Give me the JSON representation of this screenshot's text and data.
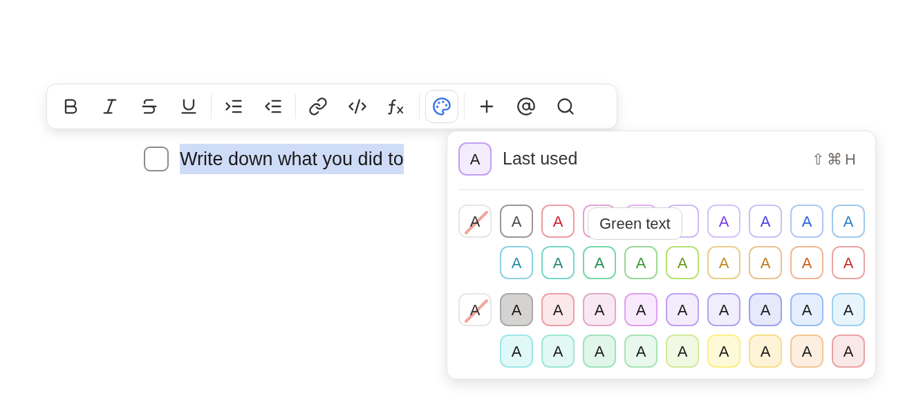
{
  "toolbar": {
    "groups": [
      [
        {
          "kind": "bold",
          "selected": false
        },
        {
          "kind": "italic",
          "selected": false
        },
        {
          "kind": "strike",
          "selected": false
        },
        {
          "kind": "underline",
          "selected": false
        }
      ],
      [
        {
          "kind": "indent",
          "selected": false
        },
        {
          "kind": "outdent",
          "selected": false
        }
      ],
      [
        {
          "kind": "link",
          "selected": false
        },
        {
          "kind": "code",
          "selected": false
        },
        {
          "kind": "formula",
          "selected": false
        }
      ],
      [
        {
          "kind": "palette",
          "selected": true
        }
      ],
      [
        {
          "kind": "plus",
          "selected": false
        },
        {
          "kind": "mention",
          "selected": false
        },
        {
          "kind": "search",
          "selected": false
        }
      ]
    ]
  },
  "task": {
    "checked": false,
    "text": "Write down what you did to"
  },
  "color_menu": {
    "last_used": {
      "label": "A",
      "color": "#f3ecfd",
      "title": "Last used",
      "shortcut": [
        "⇧",
        "⌘",
        "H"
      ]
    },
    "text_colors": {
      "none": {
        "label": "A"
      },
      "tooltip": "Green text",
      "swatches": [
        {
          "label": "A",
          "color": "#4a4a4a"
        },
        {
          "label": "A",
          "color": "#d0202f"
        },
        {
          "color": "#e8a0d0"
        },
        {
          "color": "#e0b0f0"
        },
        {
          "color": "#d0b8f4"
        },
        {
          "label": "A",
          "color": "#7a3ee0"
        },
        {
          "label": "A",
          "color": "#4a3ee0"
        },
        {
          "label": "A",
          "color": "#2c5fe0"
        },
        {
          "label": "A",
          "color": "#2a7ec8"
        },
        {
          "label": "A",
          "color": "#2a8eaa"
        },
        {
          "label": "A",
          "color": "#2a8a7a"
        },
        {
          "label": "A",
          "color": "#2a8a5a"
        },
        {
          "label": "A",
          "color": "#3a9a3a"
        },
        {
          "label": "A",
          "color": "#6a9a20"
        },
        {
          "label": "A",
          "color": "#b88a20"
        },
        {
          "label": "A",
          "color": "#c07a20"
        },
        {
          "label": "A",
          "color": "#d0601a"
        },
        {
          "label": "A",
          "color": "#c8302a"
        }
      ]
    },
    "background_colors": {
      "none": {
        "label": "A"
      },
      "swatches": [
        {
          "label": "A",
          "color": "#d4d3d2"
        },
        {
          "label": "A",
          "color": "#fbe8ea"
        },
        {
          "label": "A",
          "color": "#f8e8f2"
        },
        {
          "label": "A",
          "color": "#f8eafc"
        },
        {
          "label": "A",
          "color": "#f3ecfd"
        },
        {
          "label": "A",
          "color": "#f0eefc"
        },
        {
          "label": "A",
          "color": "#e6e8fc"
        },
        {
          "label": "A",
          "color": "#e4eefc"
        },
        {
          "label": "A",
          "color": "#e8f4fc"
        },
        {
          "label": "A",
          "color": "#e0f8f8"
        },
        {
          "label": "A",
          "color": "#e2f8f2"
        },
        {
          "label": "A",
          "color": "#e0f6ea"
        },
        {
          "label": "A",
          "color": "#e8f8ec"
        },
        {
          "label": "A",
          "color": "#f2f9e2"
        },
        {
          "label": "A",
          "color": "#fefad8"
        },
        {
          "label": "A",
          "color": "#fdf4d8"
        },
        {
          "label": "A",
          "color": "#fcefe2"
        },
        {
          "label": "A",
          "color": "#fae8e8"
        }
      ]
    }
  }
}
